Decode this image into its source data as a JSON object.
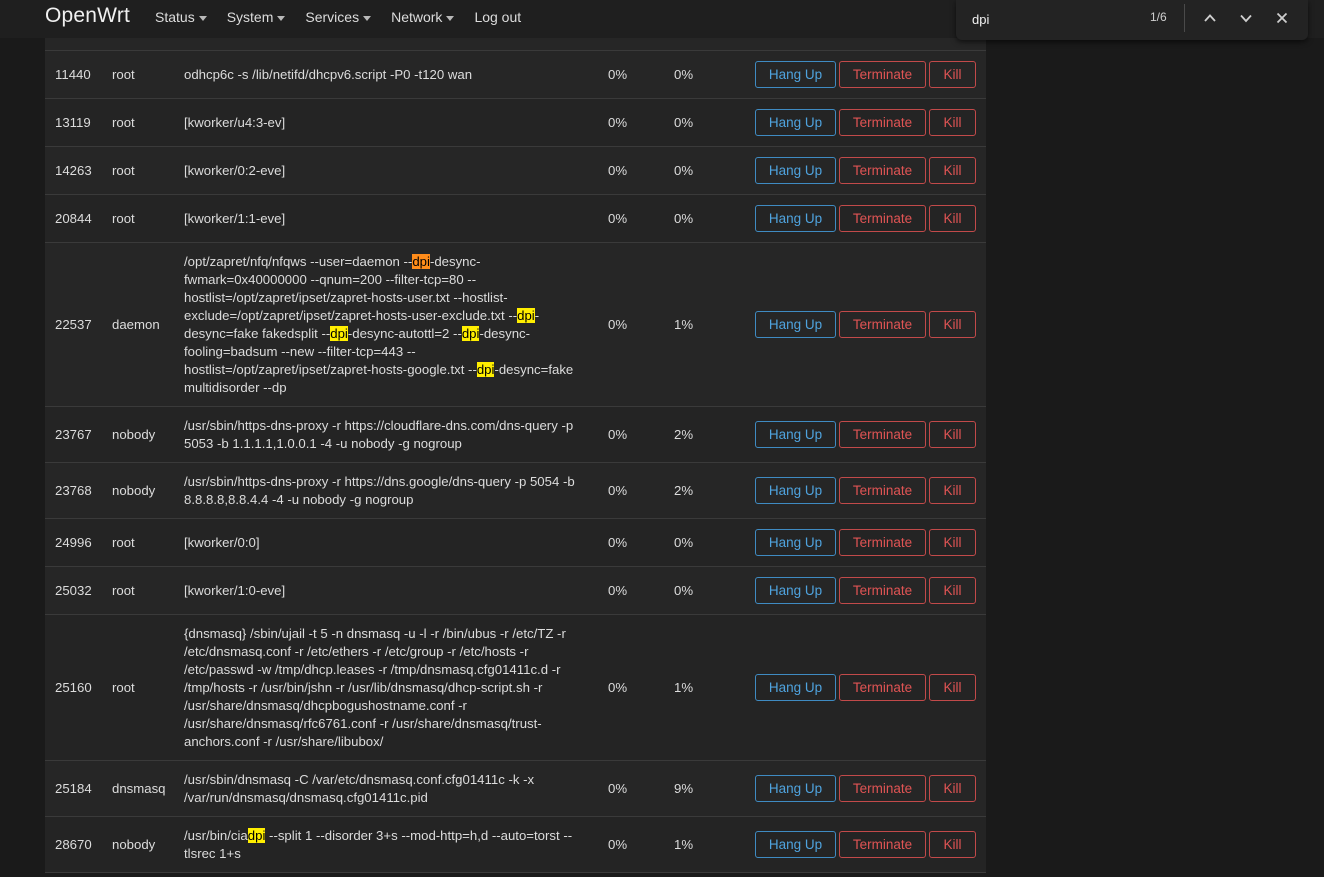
{
  "brand": "OpenWrt",
  "nav": [
    {
      "label": "Status",
      "dropdown": true
    },
    {
      "label": "System",
      "dropdown": true
    },
    {
      "label": "Services",
      "dropdown": true
    },
    {
      "label": "Network",
      "dropdown": true
    },
    {
      "label": "Log out",
      "dropdown": false
    }
  ],
  "find": {
    "query": "dpi",
    "count": "1/6"
  },
  "buttons": {
    "hang_up": "Hang Up",
    "terminate": "Terminate",
    "kill": "Kill"
  },
  "colors": {
    "accent_blue": "#4fa3de",
    "danger_red": "#e05454",
    "highlight": "#ffee00",
    "highlight_current": "#ff8c1a"
  },
  "processes": [
    {
      "pid": "11440",
      "owner": "root",
      "cmd": "odhcp6c -s /lib/netifd/dhcpv6.script -P0 -t120 wan",
      "cpu": "0%",
      "mem": "0%"
    },
    {
      "pid": "13119",
      "owner": "root",
      "cmd": "[kworker/u4:3-ev]",
      "cpu": "0%",
      "mem": "0%"
    },
    {
      "pid": "14263",
      "owner": "root",
      "cmd": "[kworker/0:2-eve]",
      "cpu": "0%",
      "mem": "0%"
    },
    {
      "pid": "20844",
      "owner": "root",
      "cmd": "[kworker/1:1-eve]",
      "cpu": "0%",
      "mem": "0%"
    },
    {
      "pid": "22537",
      "owner": "daemon",
      "cmd_parts": [
        {
          "t": "/opt/zapret/nfq/nfqws --user=daemon --"
        },
        {
          "t": "dpi",
          "hl": "cur"
        },
        {
          "t": "-desync-fwmark=0x40000000 --qnum=200 --filter-tcp=80 --hostlist=/opt/zapret/ipset/zapret-hosts-user.txt --hostlist-exclude=/opt/zapret/ipset/zapret-hosts-user-exclude.txt --"
        },
        {
          "t": "dpi",
          "hl": "yes"
        },
        {
          "t": "-desync=fake fakedsplit --"
        },
        {
          "t": "dpi",
          "hl": "yes"
        },
        {
          "t": "-desync-autottl=2 --"
        },
        {
          "t": "dpi",
          "hl": "yes"
        },
        {
          "t": "-desync-fooling=badsum --new --filter-tcp=443 --hostlist=/opt/zapret/ipset/zapret-hosts-google.txt --"
        },
        {
          "t": "dpi",
          "hl": "yes"
        },
        {
          "t": "-desync=fake multidisorder --dp"
        }
      ],
      "cpu": "0%",
      "mem": "1%"
    },
    {
      "pid": "23767",
      "owner": "nobody",
      "cmd": "/usr/sbin/https-dns-proxy -r https://cloudflare-dns.com/dns-query -p 5053 -b 1.1.1.1,1.0.0.1 -4 -u nobody -g nogroup",
      "cpu": "0%",
      "mem": "2%"
    },
    {
      "pid": "23768",
      "owner": "nobody",
      "cmd": "/usr/sbin/https-dns-proxy -r https://dns.google/dns-query -p 5054 -b 8.8.8.8,8.8.4.4 -4 -u nobody -g nogroup",
      "cpu": "0%",
      "mem": "2%"
    },
    {
      "pid": "24996",
      "owner": "root",
      "cmd": "[kworker/0:0]",
      "cpu": "0%",
      "mem": "0%"
    },
    {
      "pid": "25032",
      "owner": "root",
      "cmd": "[kworker/1:0-eve]",
      "cpu": "0%",
      "mem": "0%"
    },
    {
      "pid": "25160",
      "owner": "root",
      "cmd": "{dnsmasq} /sbin/ujail -t 5 -n dnsmasq -u -l -r /bin/ubus -r /etc/TZ -r /etc/dnsmasq.conf -r /etc/ethers -r /etc/group -r /etc/hosts -r /etc/passwd -w /tmp/dhcp.leases -r /tmp/dnsmasq.cfg01411c.d -r /tmp/hosts -r /usr/bin/jshn -r /usr/lib/dnsmasq/dhcp-script.sh -r /usr/share/dnsmasq/dhcpbogushostname.conf -r /usr/share/dnsmasq/rfc6761.conf -r /usr/share/dnsmasq/trust-anchors.conf -r /usr/share/libubox/",
      "cpu": "0%",
      "mem": "1%"
    },
    {
      "pid": "25184",
      "owner": "dnsmasq",
      "cmd": "/usr/sbin/dnsmasq -C /var/etc/dnsmasq.conf.cfg01411c -k -x /var/run/dnsmasq/dnsmasq.cfg01411c.pid",
      "cpu": "0%",
      "mem": "9%"
    },
    {
      "pid": "28670",
      "owner": "nobody",
      "cmd_parts": [
        {
          "t": "/usr/bin/cia"
        },
        {
          "t": "dpi",
          "hl": "yes"
        },
        {
          "t": " --split 1 --disorder 3+s --mod-http=h,d --auto=torst --tlsrec 1+s"
        }
      ],
      "cpu": "0%",
      "mem": "1%"
    }
  ]
}
